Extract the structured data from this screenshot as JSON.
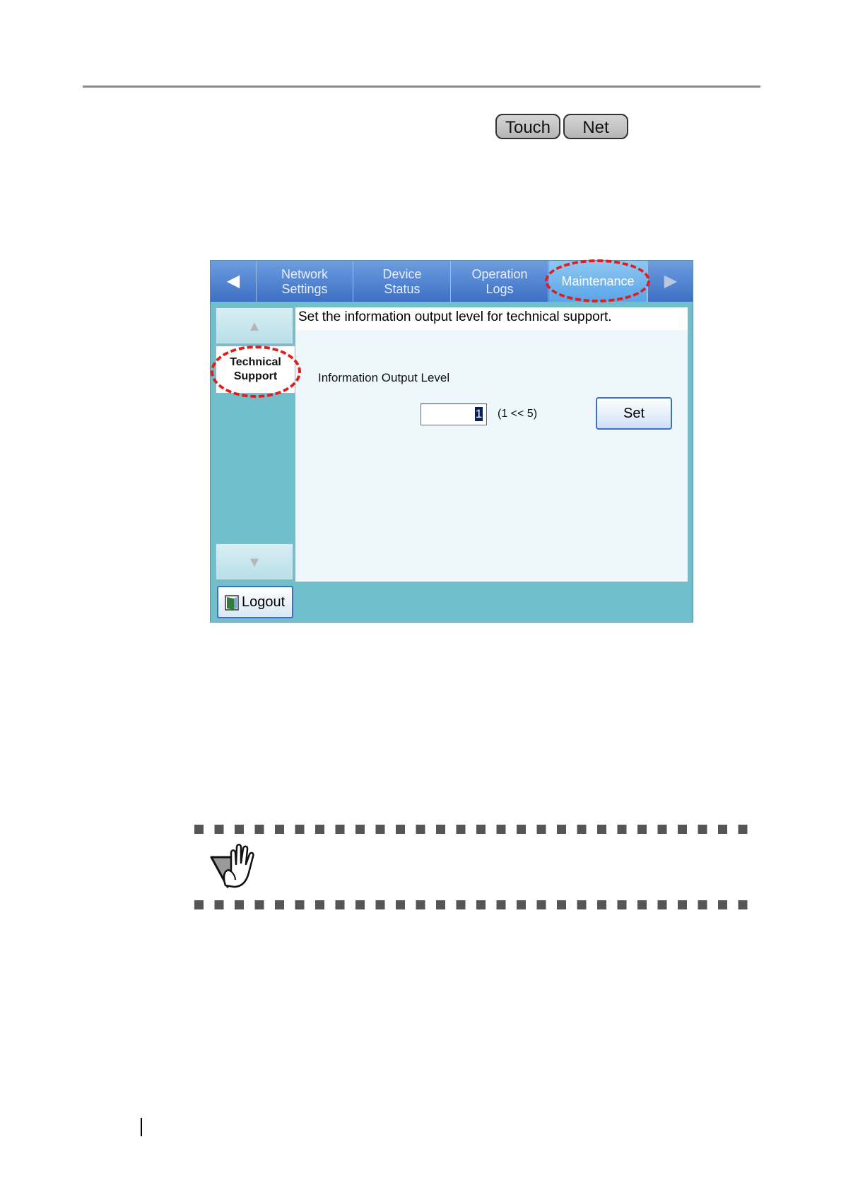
{
  "mode_badges": {
    "touch": "Touch",
    "net": "Net"
  },
  "screen": {
    "tabs": {
      "network_settings": [
        "Network",
        "Settings"
      ],
      "device_status": [
        "Device",
        "Status"
      ],
      "operation_logs": [
        "Operation",
        "Logs"
      ],
      "maintenance": "Maintenance",
      "active": "Maintenance"
    },
    "sidebar": {
      "technical_support": [
        "Technical",
        "Support"
      ]
    },
    "content": {
      "description": "Set the information output level for technical support.",
      "field_label": "Information Output Level",
      "level_value": "1",
      "range_hint": "(1 << 5)",
      "set_label": "Set"
    },
    "logout_label": "Logout"
  },
  "icons": {
    "tab_left": "left-arrow-icon",
    "tab_right": "right-arrow-icon",
    "side_up": "up-arrow-icon",
    "side_down": "down-arrow-icon",
    "logout": "door-icon",
    "caution": "stop-hand-icon"
  },
  "colors": {
    "tab_bar": "#4a7bd0",
    "active_tab": "#6cb2ec",
    "panel_bg": "#72bfcc",
    "content_bg": "#eef7fb",
    "button_border": "#3b6fc8",
    "highlight": "#e01e1e"
  }
}
